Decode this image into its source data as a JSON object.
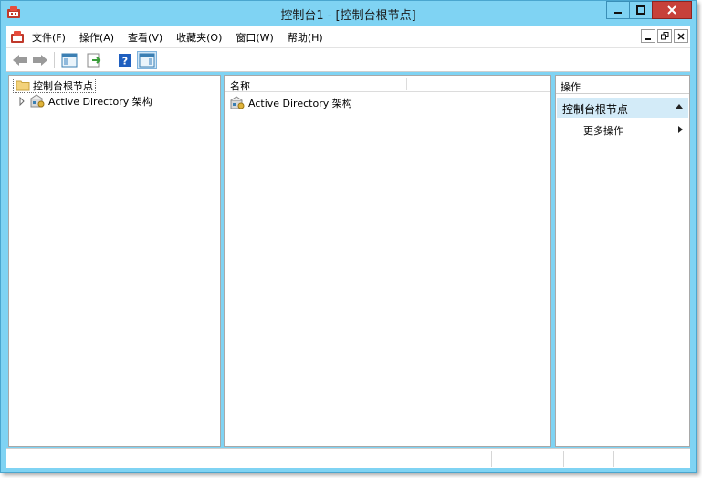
{
  "window": {
    "title": "控制台1 - [控制台根节点]",
    "accent_color": "#7fd3f3",
    "close_color": "#c7413a"
  },
  "menu": {
    "items": [
      {
        "label": "文件(F)"
      },
      {
        "label": "操作(A)"
      },
      {
        "label": "查看(V)"
      },
      {
        "label": "收藏夹(O)"
      },
      {
        "label": "窗口(W)"
      },
      {
        "label": "帮助(H)"
      }
    ]
  },
  "toolbar": {
    "icons": [
      "back-arrow-icon",
      "forward-arrow-icon",
      "show-hide-tree-icon",
      "export-list-icon",
      "help-icon",
      "show-hide-action-pane-icon"
    ]
  },
  "tree": {
    "root_label": "控制台根节点",
    "child_label": "Active Directory 架构"
  },
  "list": {
    "column_name": "名称",
    "items": [
      "Active Directory 架构"
    ]
  },
  "actions": {
    "header": "操作",
    "section_label": "控制台根节点",
    "more_actions": "更多操作",
    "section_color": "#d3ebf8"
  }
}
